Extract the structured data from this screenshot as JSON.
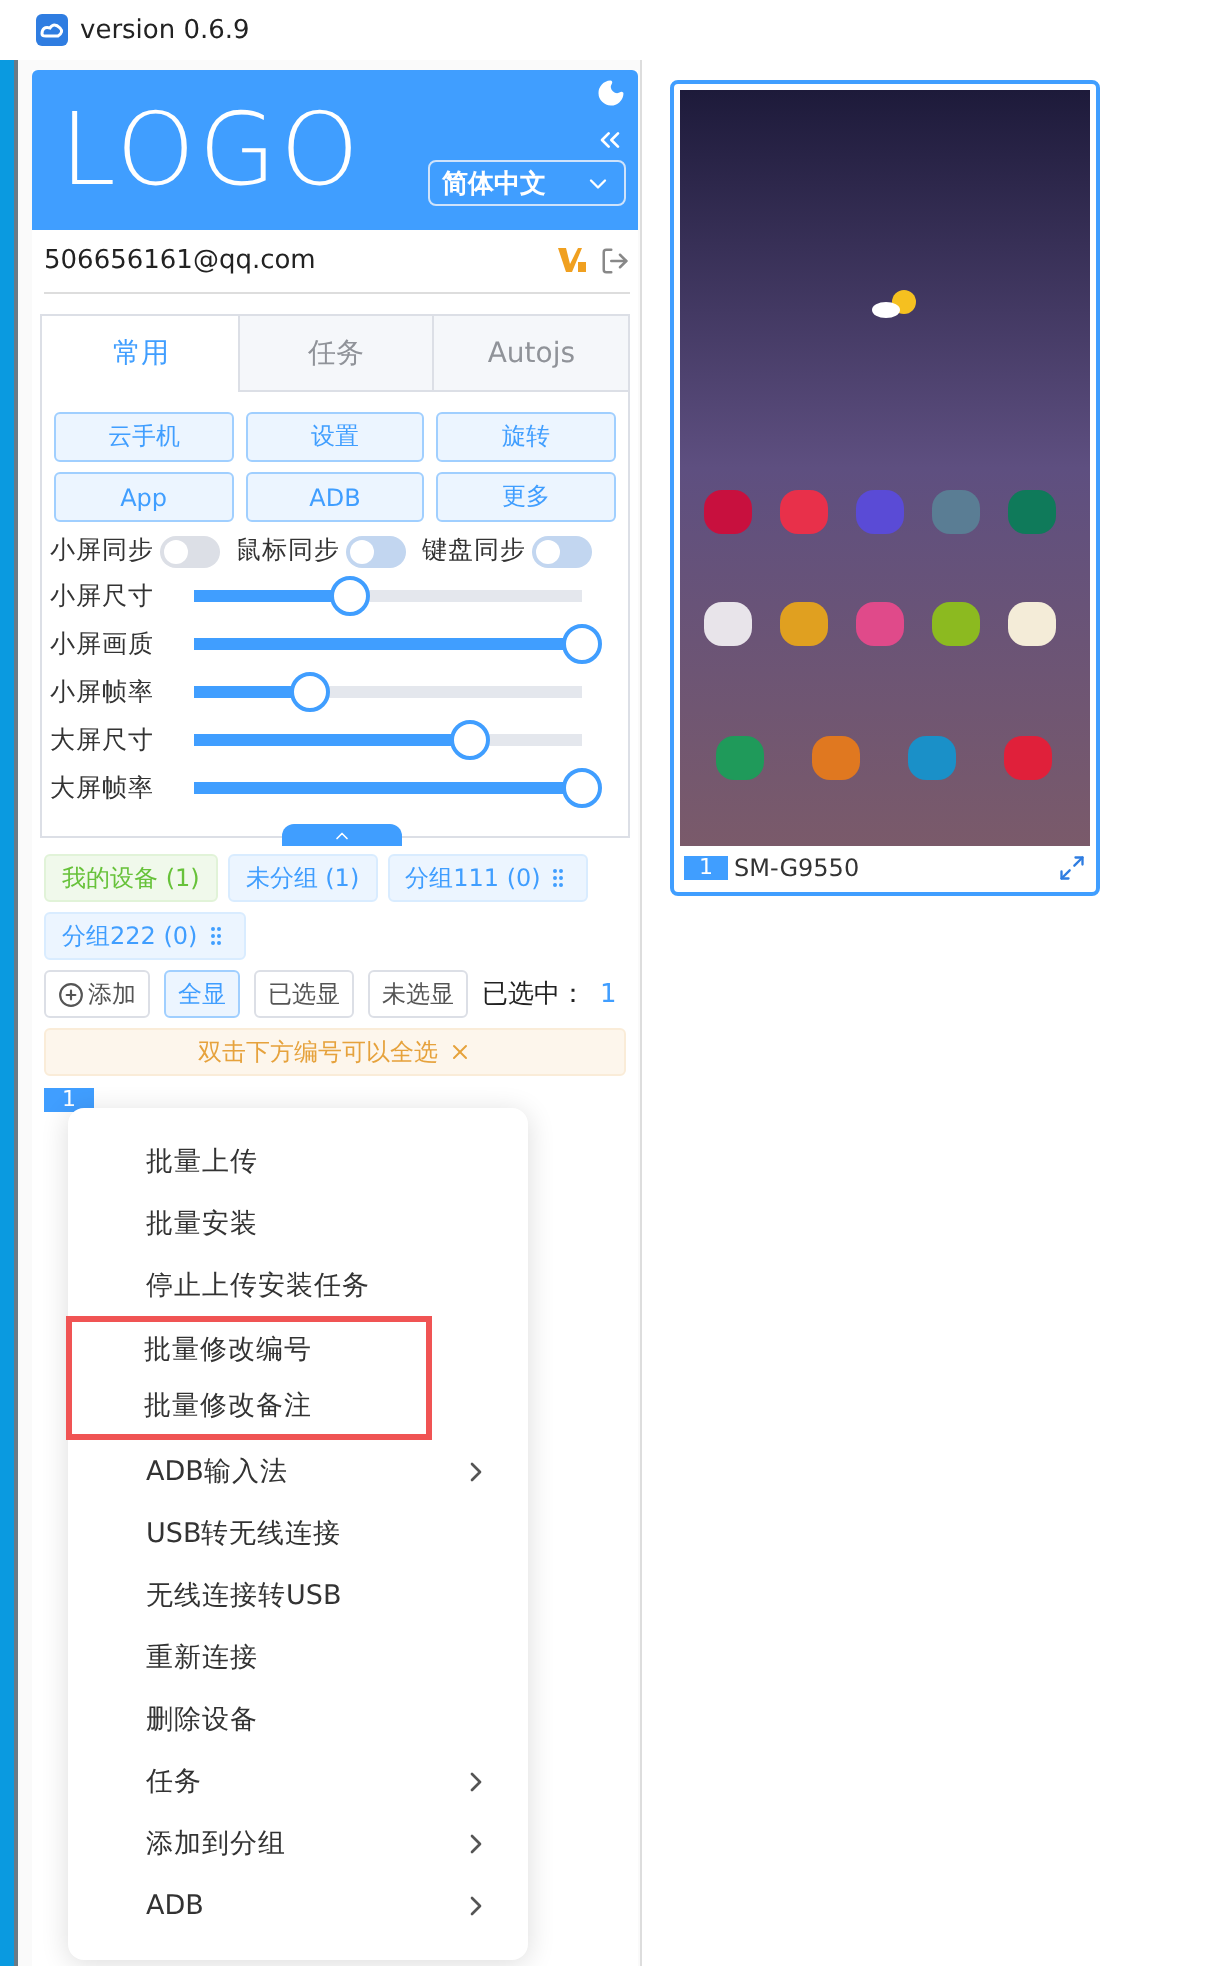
{
  "window": {
    "title": "version 0.6.9"
  },
  "header": {
    "logo": "LOGO",
    "language": "简体中文"
  },
  "account": {
    "email": "506656161@qq.com"
  },
  "tabs": [
    {
      "label": "常用",
      "selected": true
    },
    {
      "label": "任务",
      "selected": false
    },
    {
      "label": "Autojs",
      "selected": false
    }
  ],
  "action_buttons": [
    "云手机",
    "设置",
    "旋转",
    "App",
    "ADB",
    "更多"
  ],
  "toggles": [
    {
      "label": "小屏同步",
      "on": false,
      "disabled": false
    },
    {
      "label": "鼠标同步",
      "on": false,
      "disabled": true
    },
    {
      "label": "键盘同步",
      "on": false,
      "disabled": true
    }
  ],
  "sliders": [
    {
      "label": "小屏尺寸",
      "level": 0.4
    },
    {
      "label": "小屏画质",
      "level": 1
    },
    {
      "label": "小屏帧率",
      "level": 0.3
    },
    {
      "label": "大屏尺寸",
      "level": 0.71
    },
    {
      "label": "大屏帧率",
      "level": 1
    }
  ],
  "groups": [
    {
      "label": "我的设备 (1)",
      "selected": true,
      "custom": false
    },
    {
      "label": "未分组 (1)",
      "selected": false,
      "custom": false
    },
    {
      "label": "分组111 (0)",
      "selected": false,
      "custom": true
    },
    {
      "label": "分组222 (0)",
      "selected": false,
      "custom": true
    }
  ],
  "add_button": "添加",
  "filters": [
    {
      "label": "全显",
      "selected": true
    },
    {
      "label": "已选显",
      "selected": false
    },
    {
      "label": "未选显",
      "selected": false
    }
  ],
  "selected_count": {
    "label": "已选中：",
    "value": "1"
  },
  "notice": "双击下方编号可以全选",
  "device_number": "1",
  "context_menu": [
    {
      "label": "批量上传",
      "submenu": false,
      "highlighted": false
    },
    {
      "label": "批量安装",
      "submenu": false,
      "highlighted": false
    },
    {
      "label": "停止上传安装任务",
      "submenu": false,
      "highlighted": false
    },
    {
      "label": "批量修改编号",
      "submenu": false,
      "highlighted": true
    },
    {
      "label": "批量修改备注",
      "submenu": false,
      "highlighted": true
    },
    {
      "label": "ADB输入法",
      "submenu": true,
      "highlighted": false
    },
    {
      "label": "USB转无线连接",
      "submenu": false,
      "highlighted": false
    },
    {
      "label": "无线连接转USB",
      "submenu": false,
      "highlighted": false
    },
    {
      "label": "重新连接",
      "submenu": false,
      "highlighted": false
    },
    {
      "label": "删除设备",
      "submenu": false,
      "highlighted": false
    },
    {
      "label": "任务",
      "submenu": true,
      "highlighted": false
    },
    {
      "label": "添加到分组",
      "submenu": true,
      "highlighted": false
    },
    {
      "label": "ADB",
      "submenu": true,
      "highlighted": false
    }
  ],
  "device_card": {
    "number": "1",
    "model": "SM-G9550",
    "selected": true
  }
}
